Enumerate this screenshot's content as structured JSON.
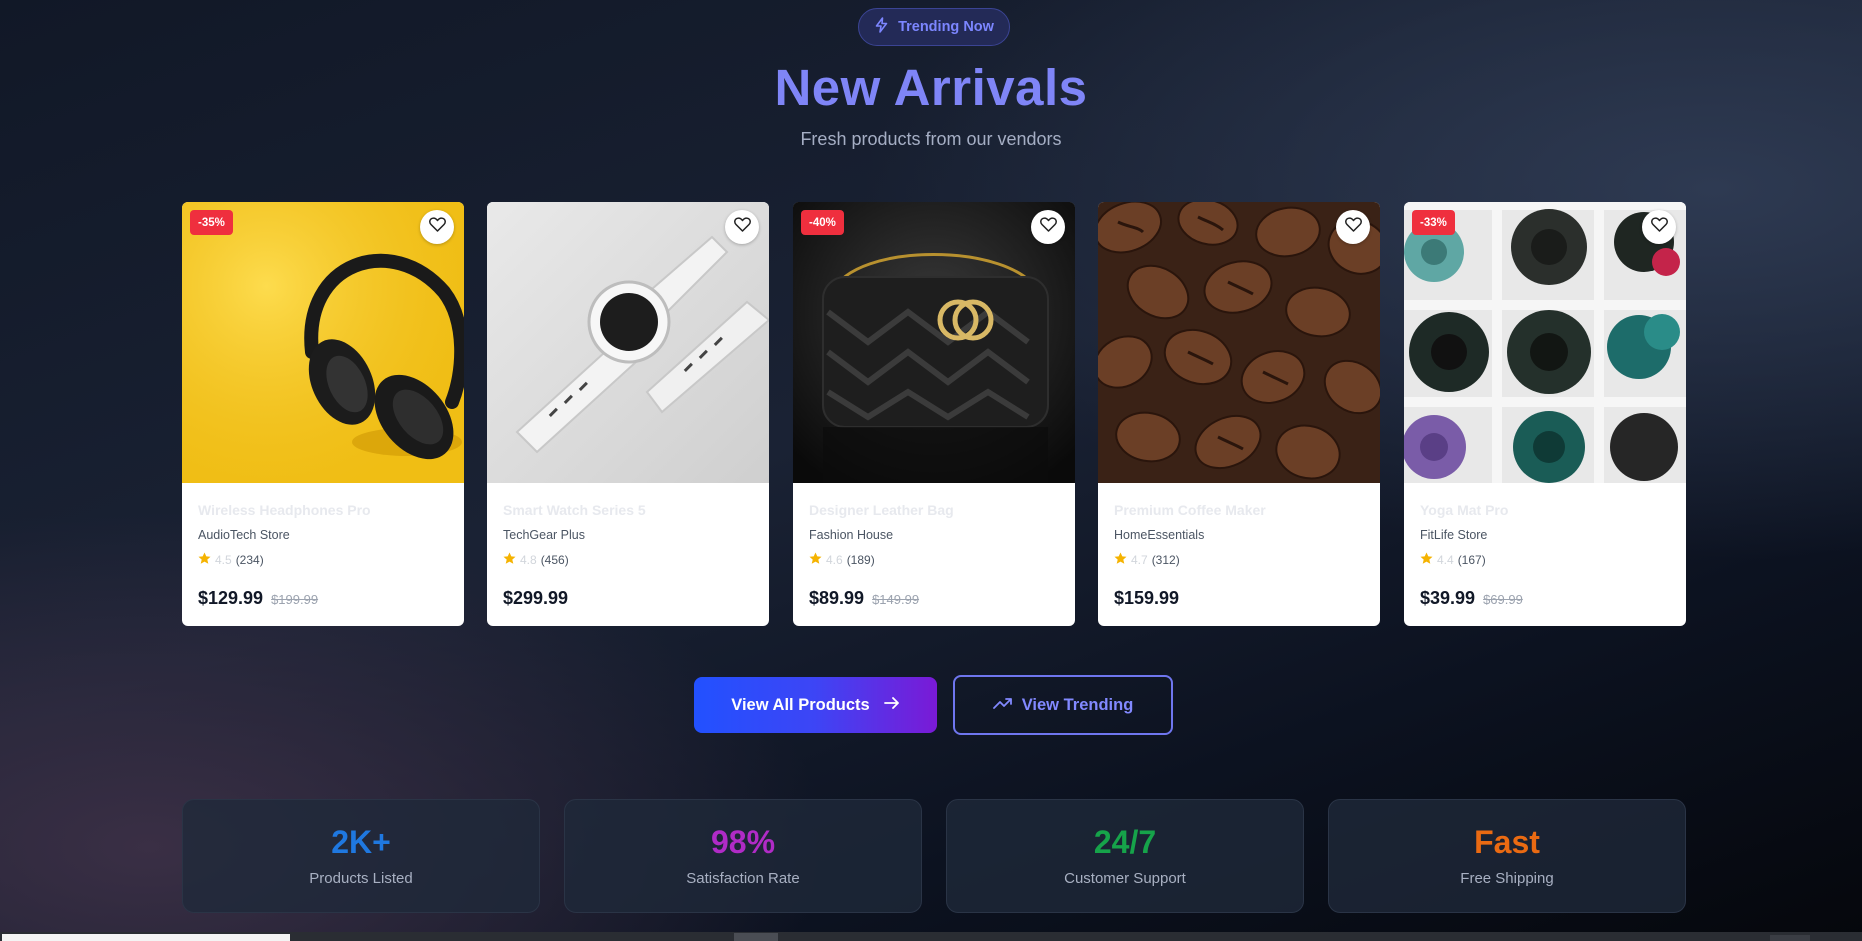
{
  "header": {
    "badge_label": "Trending Now",
    "title": "New Arrivals",
    "subtitle": "Fresh products from our vendors"
  },
  "products": [
    {
      "name": "Wireless Headphones Pro",
      "vendor": "AudioTech Store",
      "rating": "4.5",
      "reviews": "(234)",
      "price": "$129.99",
      "original_price": "$199.99",
      "discount": "-35%"
    },
    {
      "name": "Smart Watch Series 5",
      "vendor": "TechGear Plus",
      "rating": "4.8",
      "reviews": "(456)",
      "price": "$299.99",
      "original_price": "",
      "discount": ""
    },
    {
      "name": "Designer Leather Bag",
      "vendor": "Fashion House",
      "rating": "4.6",
      "reviews": "(189)",
      "price": "$89.99",
      "original_price": "$149.99",
      "discount": "-40%"
    },
    {
      "name": "Premium Coffee Maker",
      "vendor": "HomeEssentials",
      "rating": "4.7",
      "reviews": "(312)",
      "price": "$159.99",
      "original_price": "",
      "discount": ""
    },
    {
      "name": "Yoga Mat Pro",
      "vendor": "FitLife Store",
      "rating": "4.4",
      "reviews": "(167)",
      "price": "$39.99",
      "original_price": "$69.99",
      "discount": "-33%"
    }
  ],
  "actions": {
    "view_all_label": "View All Products",
    "view_trending_label": "View Trending"
  },
  "stats": [
    {
      "value": "2K+",
      "label": "Products Listed",
      "color": "#1f78e0"
    },
    {
      "value": "98%",
      "label": "Satisfaction Rate",
      "color": "#b02bc6"
    },
    {
      "value": "24/7",
      "label": "Customer Support",
      "color": "#16a34a"
    },
    {
      "value": "Fast",
      "label": "Free Shipping",
      "color": "#ea6a12"
    }
  ],
  "icons": {
    "badge": "lightning-icon",
    "favorite": "heart-icon",
    "star": "star-icon",
    "arrow": "arrow-right-icon",
    "trending": "trending-up-icon"
  },
  "colors": {
    "accent": "#7f85f7",
    "discount_badge": "#ef2f3e",
    "star": "#f5b301"
  }
}
